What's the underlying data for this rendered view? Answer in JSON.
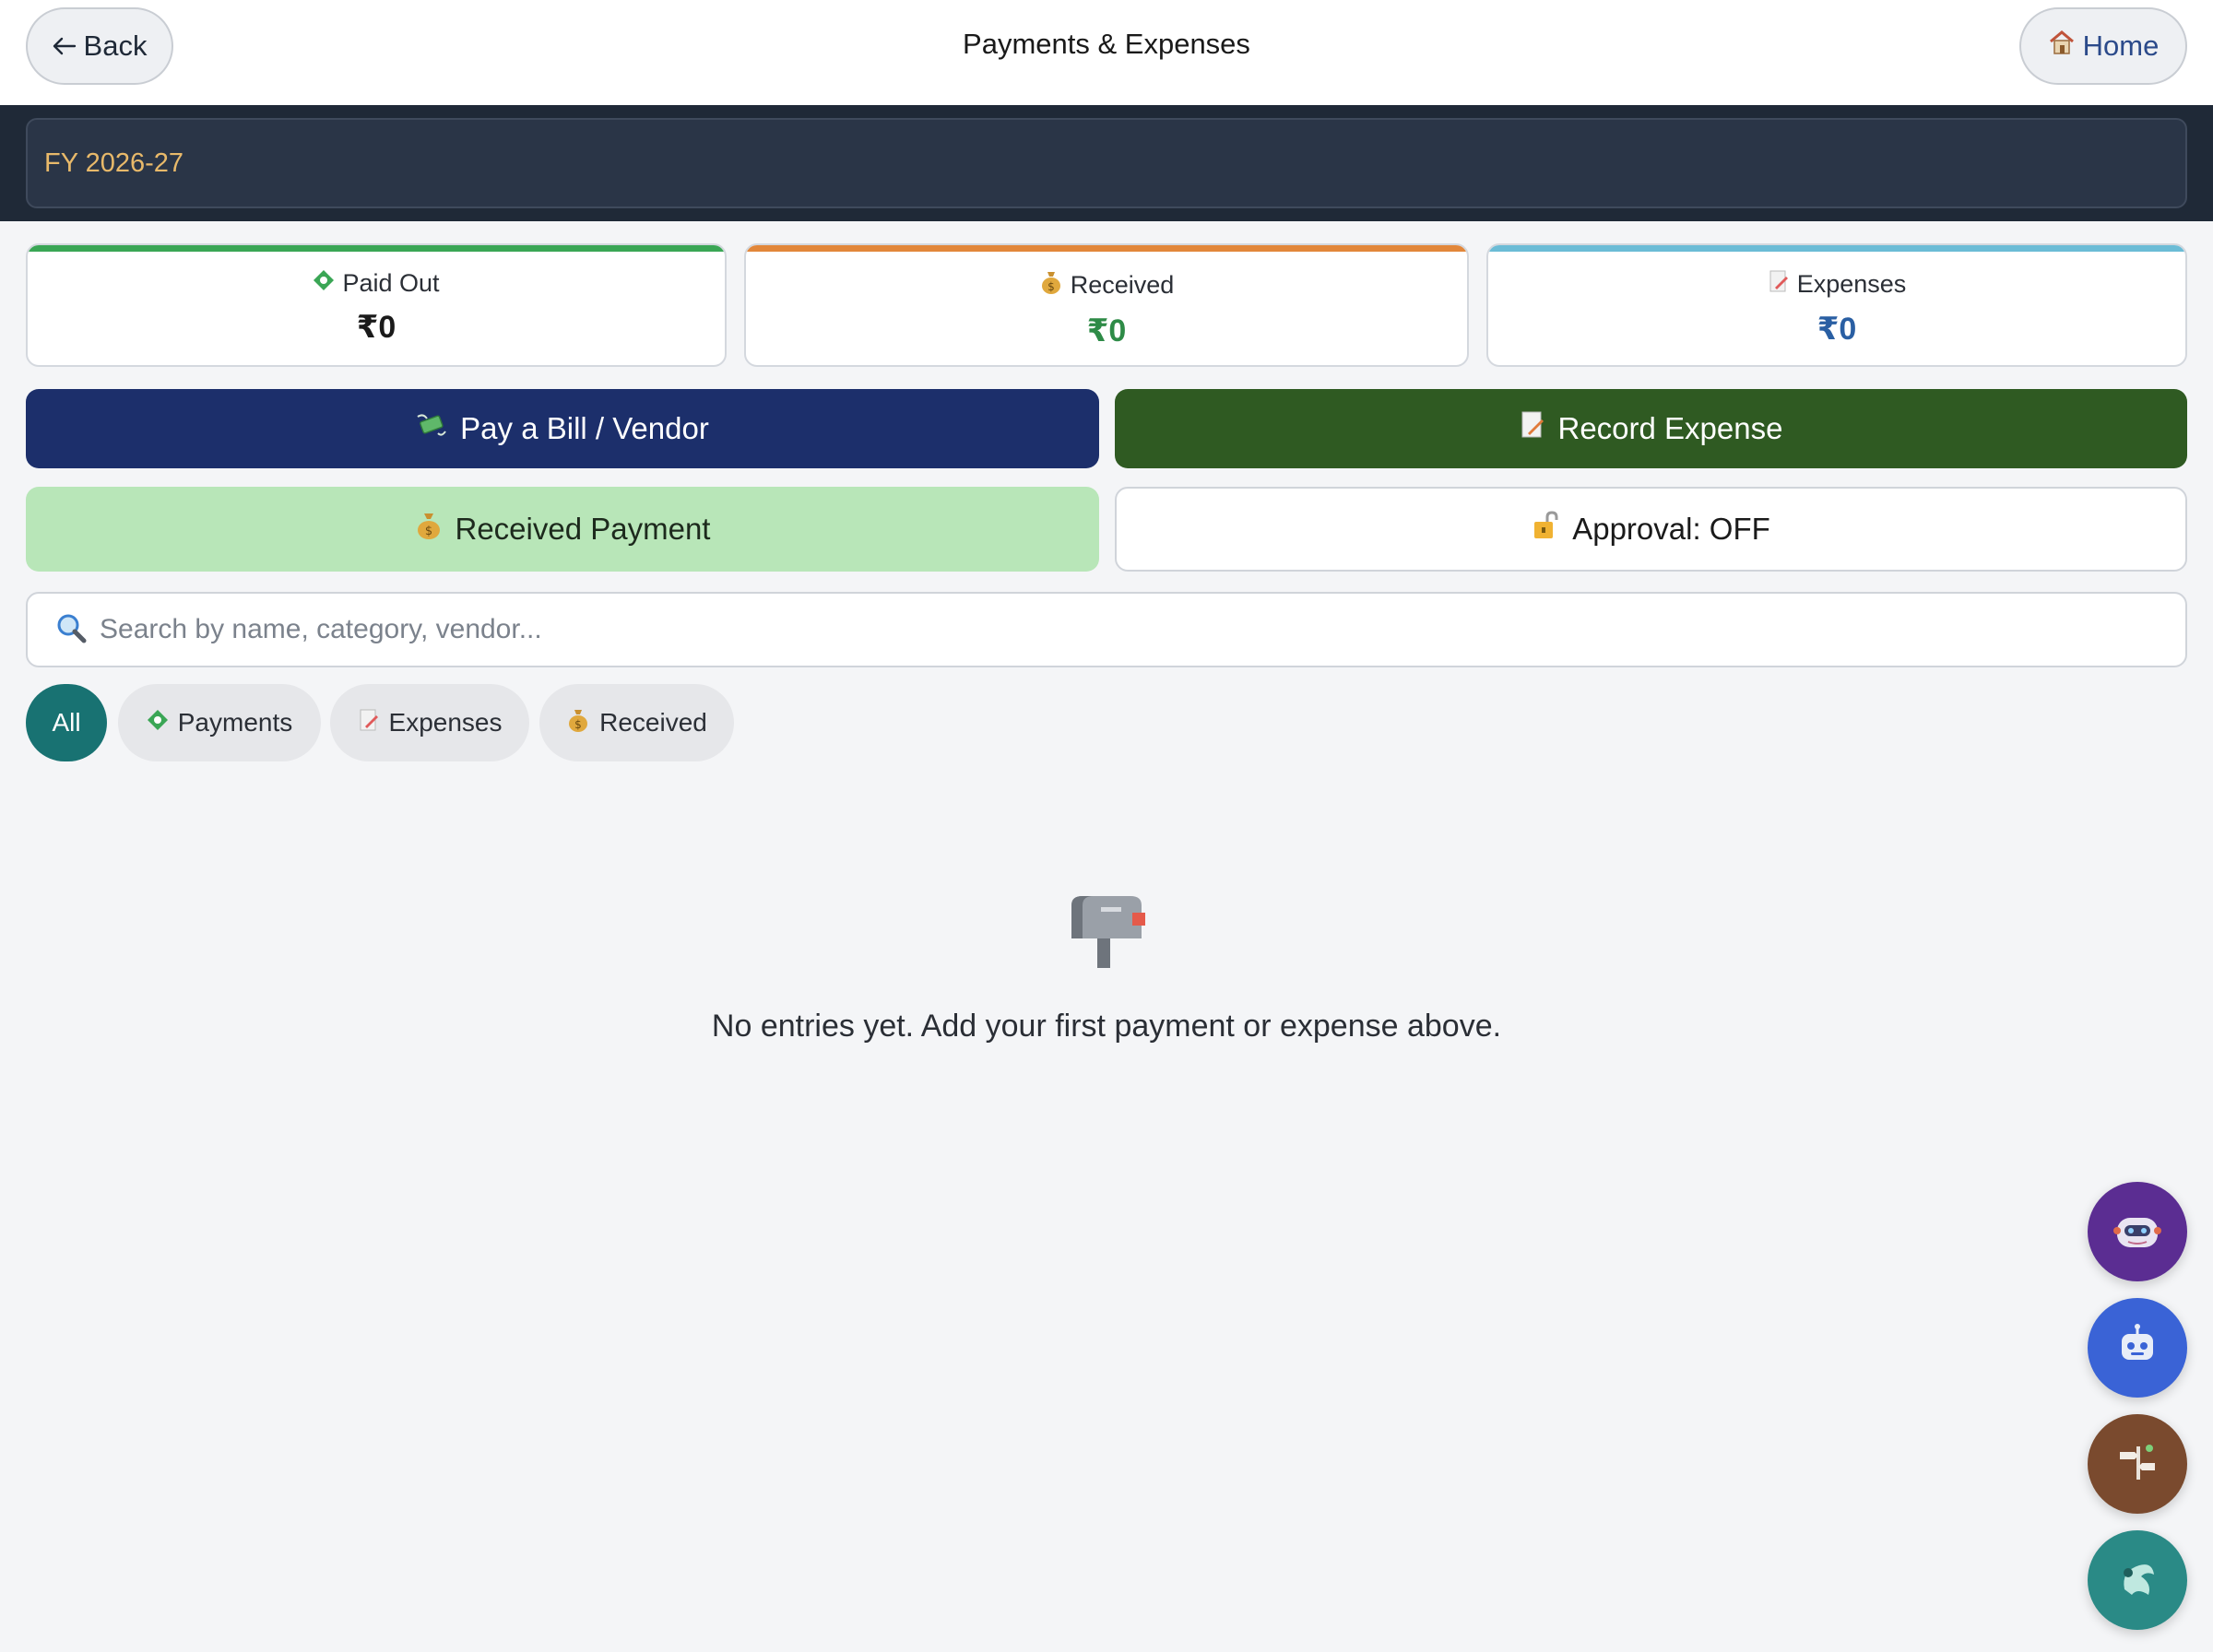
{
  "header": {
    "back_label": "Back",
    "title": "Payments & Expenses",
    "home_label": "Home"
  },
  "fiscal_year": {
    "selected": "FY 2026-27"
  },
  "stats": [
    {
      "label": "Paid Out",
      "value": "₹0",
      "accent": "#3aa655",
      "value_color": "#1a1a1a"
    },
    {
      "label": "Received",
      "value": "₹0",
      "accent": "#e2873a",
      "value_color": "#2e8b47"
    },
    {
      "label": "Expenses",
      "value": "₹0",
      "accent": "#6bbcd6",
      "value_color": "#2a5fa3"
    }
  ],
  "actions": {
    "pay_bill": "Pay a Bill / Vendor",
    "record_expense": "Record Expense",
    "received_payment": "Received Payment",
    "approval": "Approval: OFF"
  },
  "search": {
    "placeholder": "Search by name, category, vendor..."
  },
  "filters": {
    "all": "All",
    "payments": "Payments",
    "expenses": "Expenses",
    "received": "Received"
  },
  "empty_state": {
    "message": "No entries yet. Add your first payment or expense above."
  },
  "icons": {
    "back": "arrow-left-icon",
    "home": "house-icon",
    "paid_out": "diamond-icon",
    "received": "money-bag-icon",
    "expenses": "memo-icon",
    "pay_bill": "flying-money-icon",
    "approval": "unlocked-icon",
    "search": "magnifier-icon",
    "empty": "mailbox-icon"
  },
  "colors": {
    "teal_active": "#187272",
    "navy_button": "#1c2f6b",
    "green_button": "#2f5a22",
    "light_green_button": "#b8e6b8"
  }
}
